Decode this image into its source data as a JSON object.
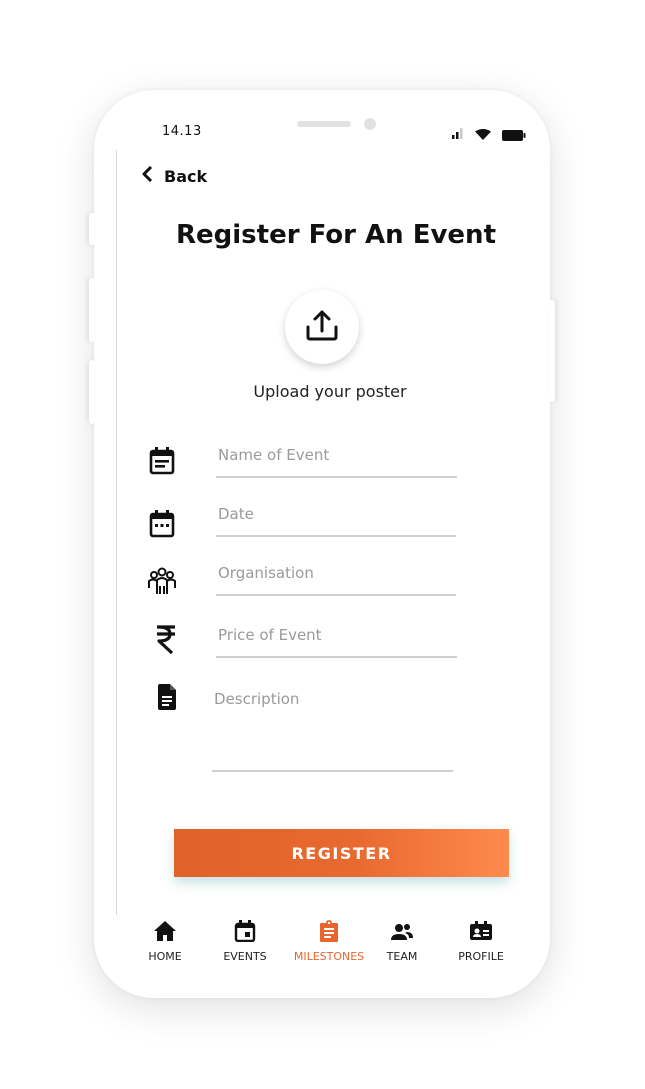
{
  "status_bar": {
    "time": "14.13"
  },
  "header": {
    "back_label": "Back",
    "title": "Register For An Event"
  },
  "upload": {
    "label": "Upload your poster"
  },
  "form": {
    "event_name": {
      "placeholder": "Name of Event",
      "value": ""
    },
    "date": {
      "placeholder": "Date",
      "value": ""
    },
    "organisation": {
      "placeholder": "Organisation",
      "value": ""
    },
    "price": {
      "placeholder": "Price of Event",
      "value": ""
    },
    "description": {
      "placeholder": "Description",
      "value": ""
    }
  },
  "actions": {
    "register_label": "REGISTER"
  },
  "bottom_nav": {
    "items": [
      {
        "label": "HOME",
        "icon": "home-icon",
        "active": false
      },
      {
        "label": "EVENTS",
        "icon": "calendar-icon",
        "active": false
      },
      {
        "label": "MILESTONES",
        "icon": "clipboard-icon",
        "active": true
      },
      {
        "label": "TEAM",
        "icon": "team-icon",
        "active": false
      },
      {
        "label": "PROFILE",
        "icon": "id-card-icon",
        "active": false
      }
    ]
  },
  "colors": {
    "accent": "#e8652e",
    "text": "#111111",
    "placeholder": "#9a9a9a"
  }
}
